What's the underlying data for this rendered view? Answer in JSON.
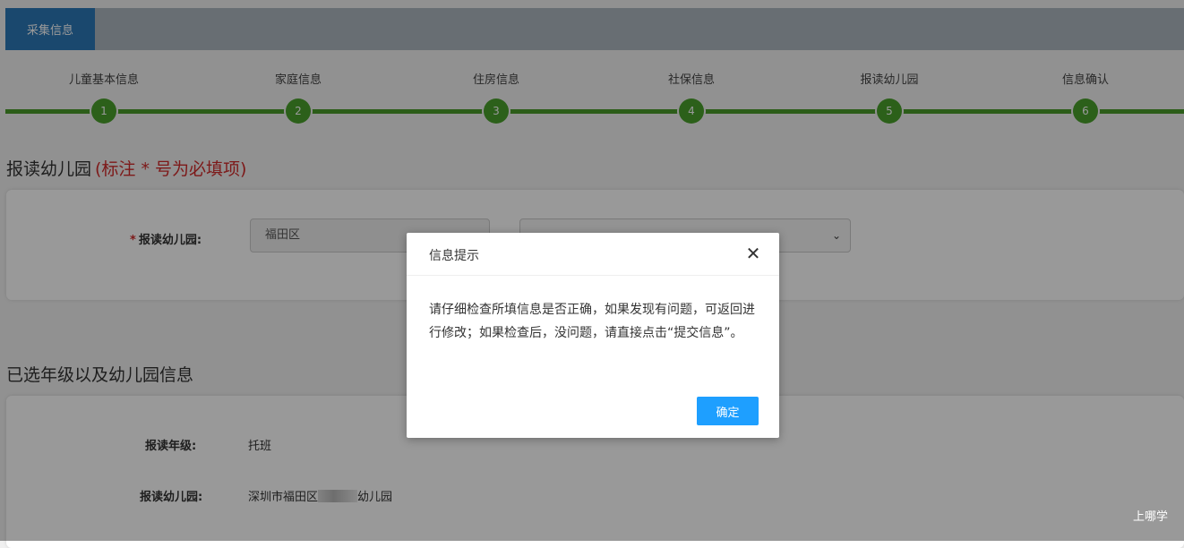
{
  "header": {
    "tab_label": "采集信息"
  },
  "steps": [
    {
      "label": "儿童基本信息",
      "num": "1"
    },
    {
      "label": "家庭信息",
      "num": "2"
    },
    {
      "label": "住房信息",
      "num": "3"
    },
    {
      "label": "社保信息",
      "num": "4"
    },
    {
      "label": "报读幼儿园",
      "num": "5"
    },
    {
      "label": "信息确认",
      "num": "6"
    }
  ],
  "section1": {
    "title": "报读幼儿园",
    "required_note": "(标注 * 号为必填项)",
    "field_label": "报读幼儿园:",
    "district_value": "福田区"
  },
  "section2": {
    "title": "已选年级以及幼儿园信息",
    "grade_label": "报读年级:",
    "grade_value": "托班",
    "kindergarten_label": "报读幼儿园:",
    "kindergarten_prefix": "深圳市福田区",
    "kindergarten_suffix": "幼儿园"
  },
  "dialog": {
    "title": "信息提示",
    "close_icon": "close-icon",
    "message": "请仔细检查所填信息是否正确，如果发现有问题，可返回进行修改；如果检查后，没问题，请直接点击“提交信息”。",
    "confirm_label": "确定"
  },
  "watermark": "上哪学",
  "colors": {
    "accent_blue": "#2c78b8",
    "step_green": "#4aa02c",
    "required_red": "#d12b2b",
    "confirm_blue": "#1e9fff"
  }
}
